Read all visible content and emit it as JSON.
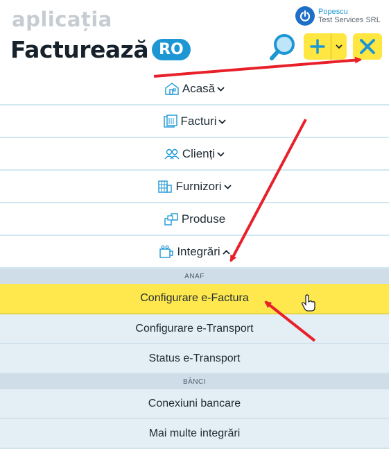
{
  "header": {
    "brand_top": "aplicația",
    "brand_main": "Facturează",
    "brand_suffix": "RO",
    "user_name": "Popescu",
    "user_company": "Test Services SRL",
    "icons": {
      "power": "power-icon",
      "search": "search-icon",
      "plus": "plus-icon",
      "close": "close-icon",
      "dropdown": "chevron-down-icon"
    }
  },
  "menu": [
    {
      "label": "Acasă",
      "icon": "home-icon",
      "chevron": "down"
    },
    {
      "label": "Facturi",
      "icon": "invoices-icon",
      "chevron": "down"
    },
    {
      "label": "Clienți",
      "icon": "clients-icon",
      "chevron": "down"
    },
    {
      "label": "Furnizori",
      "icon": "suppliers-icon",
      "chevron": "down"
    },
    {
      "label": "Produse",
      "icon": "products-icon",
      "chevron": null
    },
    {
      "label": "Integrări",
      "icon": "integrations-icon",
      "chevron": "up"
    }
  ],
  "integrations": {
    "anaf_label": "ANAF",
    "anaf_items": [
      "Configurare e-Factura",
      "Configurare e-Transport",
      "Status e-Transport"
    ],
    "banks_label": "BĂNCI",
    "banks_items": [
      "Conexiuni bancare",
      "Mai multe integrări"
    ],
    "active_item": "Configurare e-Factura"
  },
  "colors": {
    "accent_yellow": "#ffe640",
    "brand_blue": "#1d97d4",
    "annotation_red": "#e8202a",
    "submenu_bg": "#e4eef5",
    "section_bg": "#cfdde8"
  }
}
